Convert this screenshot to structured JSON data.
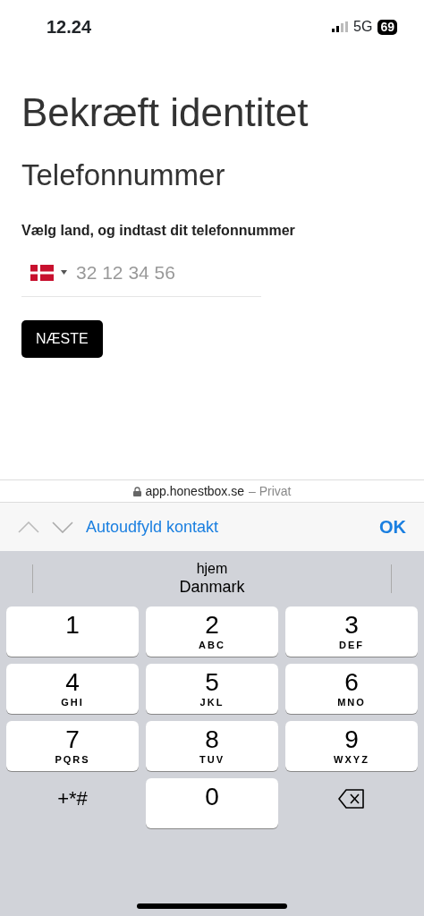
{
  "status_bar": {
    "time": "12.24",
    "network": "5G",
    "battery": "69"
  },
  "page": {
    "title": "Bekræft identitet",
    "subtitle": "Telefonnummer",
    "field_label": "Vælg land, og indtast dit telefonnummer",
    "phone": {
      "placeholder": "32 12 34 56"
    },
    "next_button": "NÆSTE"
  },
  "address_bar": {
    "domain": "app.honestbox.se",
    "mode": "– Privat"
  },
  "accessory_bar": {
    "autofill": "Autoudfyld kontakt",
    "done": "OK"
  },
  "suggestion": {
    "label": "hjem",
    "value": "Danmark"
  },
  "keypad": [
    {
      "kind": "digit",
      "digit": "1"
    },
    {
      "kind": "digit",
      "digit": "2",
      "letters": "ABC"
    },
    {
      "kind": "digit",
      "digit": "3",
      "letters": "DEF"
    },
    {
      "kind": "digit",
      "digit": "4",
      "letters": "GHI"
    },
    {
      "kind": "digit",
      "digit": "5",
      "letters": "JKL"
    },
    {
      "kind": "digit",
      "digit": "6",
      "letters": "MNO"
    },
    {
      "kind": "digit",
      "digit": "7",
      "letters": "PQRS"
    },
    {
      "kind": "digit",
      "digit": "8",
      "letters": "TUV"
    },
    {
      "kind": "digit",
      "digit": "9",
      "letters": "WXYZ"
    },
    {
      "kind": "symbols",
      "label": "+*#"
    },
    {
      "kind": "digit",
      "digit": "0"
    },
    {
      "kind": "delete"
    }
  ]
}
